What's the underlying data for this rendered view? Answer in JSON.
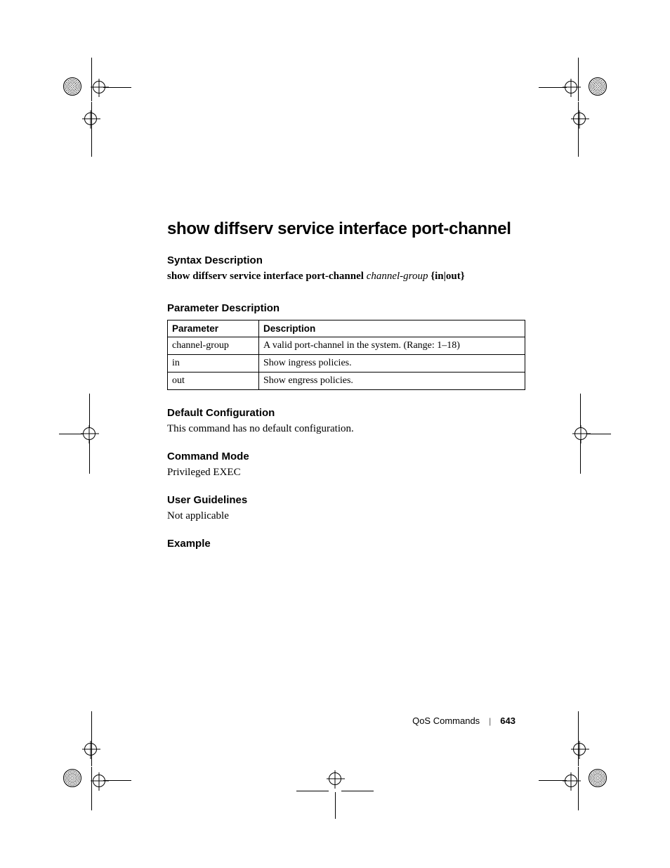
{
  "title": "show diffserv service interface port-channel",
  "sections": {
    "syntax_heading": "Syntax Description",
    "syntax_cmd_bold": "show diffserv service interface port-channel",
    "syntax_param_italic": "channel-group",
    "syntax_braces": "{in|out}",
    "param_heading": "Parameter Description",
    "param_table": {
      "headers": {
        "param": "Parameter",
        "desc": "Description"
      },
      "rows": [
        {
          "param": "channel-group",
          "desc": "A valid port-channel in the system. (Range: 1–18)"
        },
        {
          "param": "in",
          "desc": "Show ingress policies."
        },
        {
          "param": "out",
          "desc": "Show engress policies."
        }
      ]
    },
    "default_heading": "Default Configuration",
    "default_text": "This command has no default configuration.",
    "mode_heading": "Command Mode",
    "mode_text": "Privileged EXEC",
    "guidelines_heading": "User Guidelines",
    "guidelines_text": "Not applicable",
    "example_heading": "Example"
  },
  "footer": {
    "section": "QoS Commands",
    "page": "643"
  }
}
